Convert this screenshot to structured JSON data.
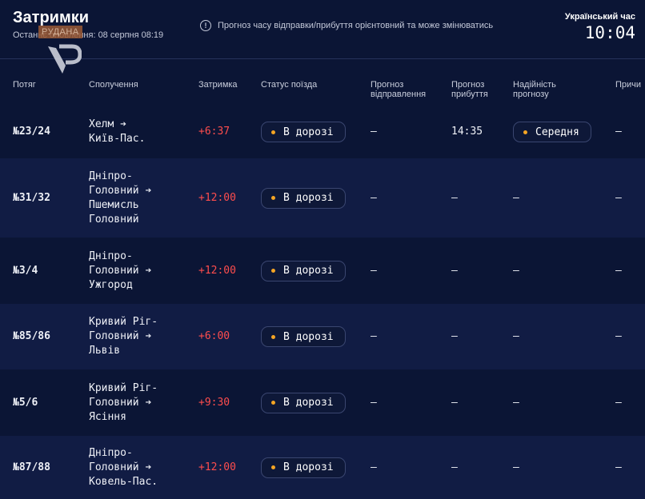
{
  "header": {
    "title": "Затримки",
    "updated": "Останнє оновлення: 08 серпня 08:19",
    "notice": "Прогноз часу відправки/прибуття орієнтовний та може змінюватись",
    "clock_label": "Український час",
    "clock_time": "10:04"
  },
  "brand": {
    "label": "РУДАНА"
  },
  "columns": {
    "train": "Потяг",
    "route": "Сполучення",
    "delay": "Затримка",
    "status": "Статус поїзда",
    "dep": "Прогноз відправлення",
    "arr": "Прогноз прибуття",
    "rel": "Надійність прогнозу",
    "reason": "Причи"
  },
  "rows": [
    {
      "train": "№23/24",
      "route": "Хелм ➔\nКиїв-Пас.",
      "delay": "+6:37",
      "status": "В дорозі",
      "dep": "—",
      "arr": "14:35",
      "rel": "Середня",
      "reason": "—"
    },
    {
      "train": "№31/32",
      "route": "Дніпро-\nГоловний ➔\nПшемисль\nГоловний",
      "delay": "+12:00",
      "status": "В дорозі",
      "dep": "—",
      "arr": "—",
      "rel": "—",
      "reason": "—"
    },
    {
      "train": "№3/4",
      "route": "Дніпро-\nГоловний ➔\nУжгород",
      "delay": "+12:00",
      "status": "В дорозі",
      "dep": "—",
      "arr": "—",
      "rel": "—",
      "reason": "—"
    },
    {
      "train": "№85/86",
      "route": "Кривий Ріг-\nГоловний ➔\nЛьвів",
      "delay": "+6:00",
      "status": "В дорозі",
      "dep": "—",
      "arr": "—",
      "rel": "—",
      "reason": "—"
    },
    {
      "train": "№5/6",
      "route": "Кривий Ріг-\nГоловний ➔\nЯсіння",
      "delay": "+9:30",
      "status": "В дорозі",
      "dep": "—",
      "arr": "—",
      "rel": "—",
      "reason": "—"
    },
    {
      "train": "№87/88",
      "route": "Дніпро-\nГоловний ➔\nКовель-Пас.",
      "delay": "+12:00",
      "status": "В дорозі",
      "dep": "—",
      "arr": "—",
      "rel": "—",
      "reason": "—"
    }
  ],
  "colors": {
    "background": "#0b1535",
    "row_alt": "#111c44",
    "delay": "#ff4d4d",
    "status_dot": "#f5a524"
  }
}
